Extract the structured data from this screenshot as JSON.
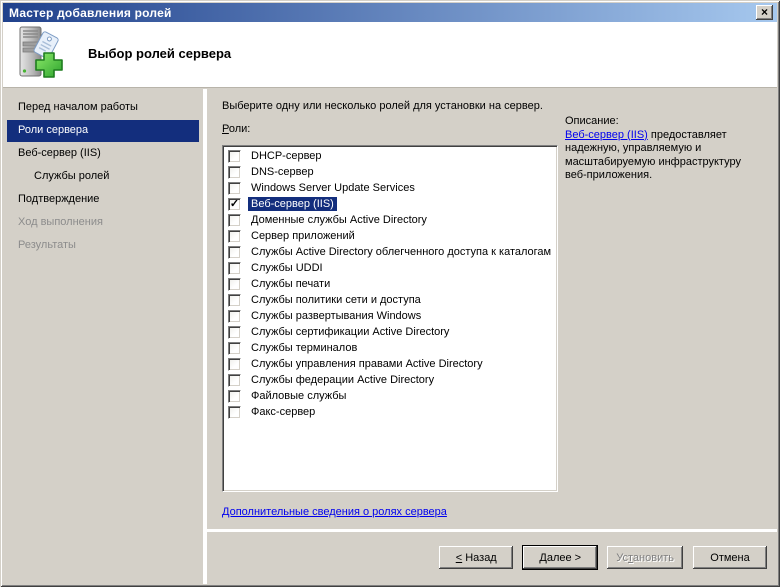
{
  "window": {
    "title": "Мастер добавления ролей"
  },
  "titlebar_icons": {
    "close": "×"
  },
  "header": {
    "title": "Выбор ролей сервера",
    "icon": "server-with-green-plus-icon"
  },
  "sidebar": {
    "items": [
      {
        "label": "Перед началом работы",
        "state": "normal",
        "indent": false
      },
      {
        "label": "Роли сервера",
        "state": "selected",
        "indent": false
      },
      {
        "label": "Веб-сервер (IIS)",
        "state": "normal",
        "indent": false
      },
      {
        "label": "Службы ролей",
        "state": "normal",
        "indent": true
      },
      {
        "label": "Подтверждение",
        "state": "normal",
        "indent": false
      },
      {
        "label": "Ход выполнения",
        "state": "disabled",
        "indent": false
      },
      {
        "label": "Результаты",
        "state": "disabled",
        "indent": false
      }
    ]
  },
  "main": {
    "instruction": "Выберите одну или несколько ролей для установки на сервер.",
    "roles_label": "Роли:",
    "roles_label_mnemonic": 0,
    "roles": [
      {
        "label": "DHCP-сервер",
        "checked": false,
        "selected": false
      },
      {
        "label": "DNS-сервер",
        "checked": false,
        "selected": false
      },
      {
        "label": "Windows Server Update Services",
        "checked": false,
        "selected": false
      },
      {
        "label": "Веб-сервер (IIS)",
        "checked": true,
        "selected": true
      },
      {
        "label": "Доменные службы Active Directory",
        "checked": false,
        "selected": false
      },
      {
        "label": "Сервер приложений",
        "checked": false,
        "selected": false
      },
      {
        "label": "Службы Active Directory облегченного доступа к каталогам",
        "checked": false,
        "selected": false
      },
      {
        "label": "Службы UDDI",
        "checked": false,
        "selected": false
      },
      {
        "label": "Службы печати",
        "checked": false,
        "selected": false
      },
      {
        "label": "Службы политики сети и доступа",
        "checked": false,
        "selected": false
      },
      {
        "label": "Службы развертывания Windows",
        "checked": false,
        "selected": false
      },
      {
        "label": "Службы сертификации Active Directory",
        "checked": false,
        "selected": false
      },
      {
        "label": "Службы терминалов",
        "checked": false,
        "selected": false
      },
      {
        "label": "Службы управления правами Active Directory",
        "checked": false,
        "selected": false
      },
      {
        "label": "Службы федерации Active Directory",
        "checked": false,
        "selected": false
      },
      {
        "label": "Файловые службы",
        "checked": false,
        "selected": false
      },
      {
        "label": "Факс-сервер",
        "checked": false,
        "selected": false
      }
    ],
    "more_info_link": "Дополнительные сведения о ролях сервера"
  },
  "description": {
    "heading": "Описание:",
    "link": "Веб-сервер (IIS)",
    "text": "предоставляет надежную, управляемую и масштабируемую инфраструктуру веб-приложения."
  },
  "buttons": {
    "back": {
      "label": "< Назад",
      "mnemonic": 0,
      "enabled": true,
      "default": false
    },
    "next": {
      "label": "Далее >",
      "mnemonic": 0,
      "enabled": true,
      "default": true
    },
    "install": {
      "label": "Установить",
      "mnemonic": 2,
      "enabled": false,
      "default": false
    },
    "cancel": {
      "label": "Отмена",
      "mnemonic": -1,
      "enabled": true,
      "default": false
    }
  },
  "icons": {
    "checkmark": "✓"
  },
  "colors": {
    "titlebar_left": "#20418c",
    "titlebar_right": "#a6c8ee",
    "face": "#d4d0c8",
    "highlight": "#132e7d",
    "link": "#0000ee",
    "disabled_text": "#808080",
    "header_bg": "#ffffff"
  }
}
